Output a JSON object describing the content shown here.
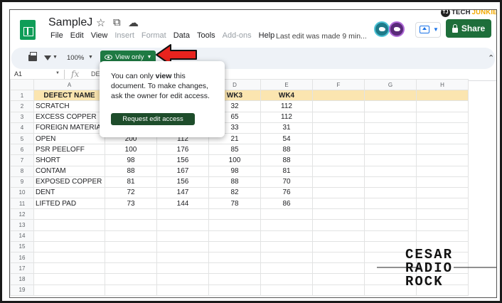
{
  "app": {
    "title": "SampleJ",
    "menu": [
      "File",
      "Edit",
      "View",
      "Insert",
      "Format",
      "Data",
      "Tools",
      "Add-ons",
      "Help"
    ],
    "menu_dim": [
      false,
      false,
      false,
      true,
      true,
      false,
      false,
      true,
      false
    ],
    "last_edit": "Last edit was made 9 min...",
    "share_label": "Share",
    "branding": {
      "tj_letters": "TJ",
      "name_prefix": "TECH",
      "name_suffix": "JUNKIE"
    }
  },
  "toolbar": {
    "zoom": "100%",
    "view_only_label": "View only"
  },
  "formula_bar": {
    "cell_ref": "A1",
    "fx": "fx",
    "content": "DE"
  },
  "popup": {
    "line1_prefix": "You can only ",
    "line1_bold": "view",
    "line1_suffix": " this",
    "line2": "document. To make changes,",
    "line3": "ask the owner for edit access.",
    "button_label": "Request edit access"
  },
  "grid": {
    "columns": [
      "A",
      "B",
      "C",
      "D",
      "E",
      "F",
      "G",
      "H"
    ],
    "row_numbers": [
      "1",
      "2",
      "3",
      "4",
      "5",
      "6",
      "7",
      "8",
      "9",
      "10",
      "11",
      "12",
      "13",
      "14",
      "15",
      "16",
      "17",
      "18",
      "19"
    ],
    "rows": [
      [
        "DEFECT NAME",
        "",
        "",
        "WK3",
        "WK4",
        "",
        "",
        ""
      ],
      [
        "SCRATCH",
        "",
        "",
        "32",
        "112",
        "",
        "",
        ""
      ],
      [
        "EXCESS COPPER",
        "",
        "",
        "65",
        "112",
        "",
        "",
        ""
      ],
      [
        "FOREIGN MATERIA",
        "",
        "",
        "33",
        "31",
        "",
        "",
        ""
      ],
      [
        "OPEN",
        "200",
        "112",
        "21",
        "54",
        "",
        "",
        ""
      ],
      [
        "PSR PEELOFF",
        "100",
        "176",
        "85",
        "88",
        "",
        "",
        ""
      ],
      [
        "SHORT",
        "98",
        "156",
        "100",
        "88",
        "",
        "",
        ""
      ],
      [
        "CONTAM",
        "88",
        "167",
        "98",
        "81",
        "",
        "",
        ""
      ],
      [
        "EXPOSED COPPER",
        "81",
        "156",
        "88",
        "70",
        "",
        "",
        ""
      ],
      [
        "DENT",
        "72",
        "147",
        "82",
        "76",
        "",
        "",
        ""
      ],
      [
        "LIFTED PAD",
        "73",
        "144",
        "78",
        "86",
        "",
        "",
        ""
      ],
      [
        "",
        "",
        "",
        "",
        "",
        "",
        "",
        ""
      ],
      [
        "",
        "",
        "",
        "",
        "",
        "",
        "",
        ""
      ],
      [
        "",
        "",
        "",
        "",
        "",
        "",
        "",
        ""
      ],
      [
        "",
        "",
        "",
        "",
        "",
        "",
        "",
        ""
      ],
      [
        "",
        "",
        "",
        "",
        "",
        "",
        "",
        ""
      ],
      [
        "",
        "",
        "",
        "",
        "",
        "",
        "",
        ""
      ],
      [
        "",
        "",
        "",
        "",
        "",
        "",
        "",
        ""
      ],
      [
        "",
        "",
        "",
        "",
        "",
        "",
        "",
        ""
      ]
    ]
  },
  "watermark": {
    "line1": "CESAR",
    "line2": "RADIO",
    "line3": "ROCK"
  },
  "colors": {
    "brand_green": "#0f9d58",
    "share_green": "#1e6e3a",
    "header_fill": "#fbe5b0",
    "arrow_red": "#e8231e"
  }
}
